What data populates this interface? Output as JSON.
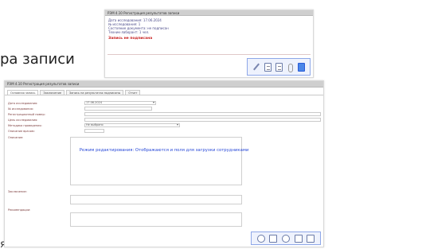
{
  "heading": {
    "text": "ра записи"
  },
  "bottom_fragment": {
    "text": "я"
  },
  "top_panel": {
    "title": "РЭМ 4.10 Регистрация результатов записи",
    "lines": [
      "Дата исследования: 17.06.2024",
      "№ исследования: 1",
      "Состояние документа: не подписан",
      "Техник-лаборант: 1 чел."
    ],
    "warning": "Запись не подписана"
  },
  "bottom_panel": {
    "title": "РЭМ 4.10 Регистрация результатов записи",
    "tabs": [
      "Основная запись",
      "Заключение",
      "Запись на результатах подписаны",
      "Отчет"
    ],
    "fields": [
      {
        "label": "Дата исследования:",
        "value": "17.06.2024"
      },
      {
        "label": "№ исследования:",
        "value": ""
      },
      {
        "label": "Регистрационный номер:",
        "value": ""
      },
      {
        "label": "Цель исследования:",
        "value": ""
      },
      {
        "label": "Методика проведения:",
        "value": "Не выбрано"
      },
      {
        "label": "Описание врачом:",
        "value": ""
      },
      {
        "label": "Описание:",
        "value": ""
      }
    ],
    "section_labels": {
      "conclusion": "Заключение:",
      "recommendation": "Рекомендации:"
    },
    "note": "Режим редактирования: Отображаются и поля для загрузки сотрудниками"
  },
  "colors": {
    "toolbar_border": "#8ea7e8",
    "warning_red": "#c72020",
    "note_blue": "#2748d8",
    "warn_icon": "#f3b91e"
  },
  "icons": {
    "top_toolbar": [
      "pencil-icon",
      "document-icon",
      "print-icon",
      "paperclip-icon",
      "edit-blue-icon"
    ],
    "bottom_toolbar": [
      "round-icon",
      "save-icon",
      "refresh-icon",
      "copy-icon",
      "document-icon"
    ]
  }
}
